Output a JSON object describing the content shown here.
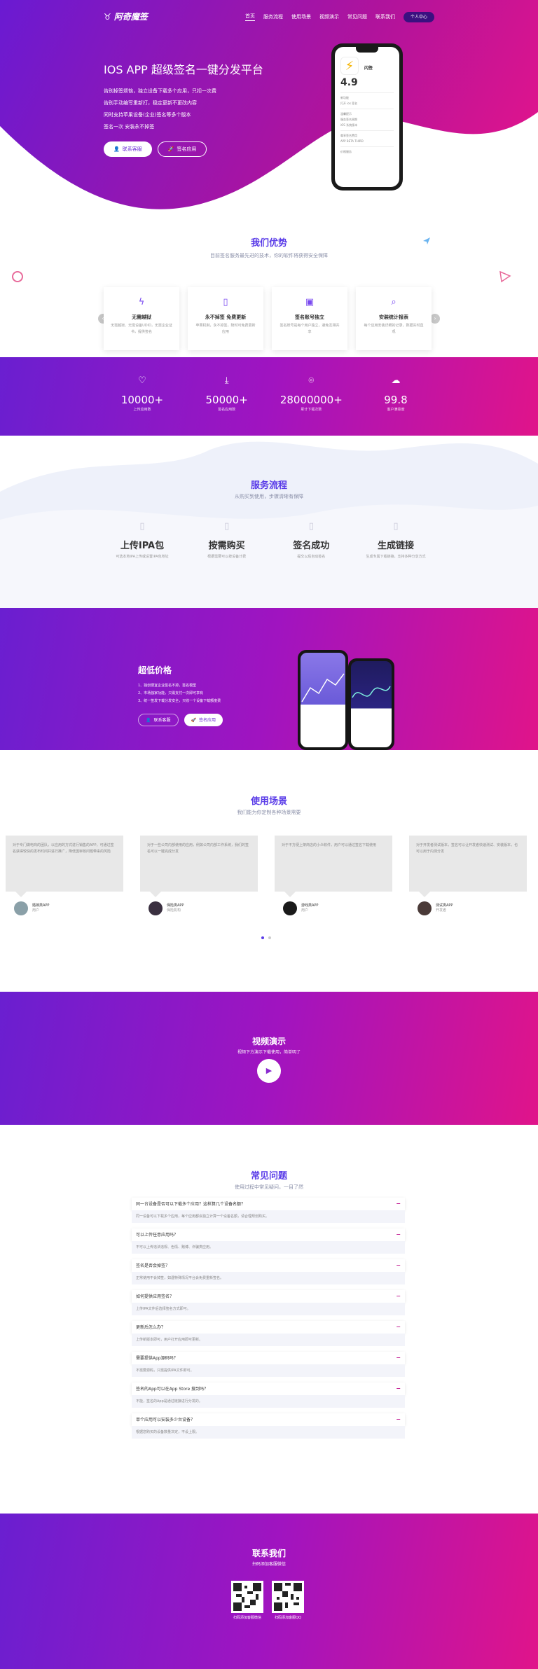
{
  "nav": {
    "brand": "阿奇魔签",
    "items": [
      "首页",
      "服务流程",
      "使用场景",
      "视频演示",
      "常见问题",
      "联系我们"
    ],
    "user_center": "个人中心"
  },
  "hero": {
    "title": "IOS APP 超级签名一键分发平台",
    "lines": [
      "告别掉签烦恼，独立设备下载多个应用，只扣一次费",
      "告别手动编写重新打，稳定更新不更改内容",
      "同时支持苹果设备(企业)签名等多个版本",
      "签名一次 安装永不掉签"
    ],
    "btn_contact": "联系客服",
    "btn_sign": "签名应用"
  },
  "phone": {
    "app": "闪签",
    "rating": "4.9",
    "lines": [
      "新功能",
      "打开 ios 签名",
      "温馨提示",
      "服务签名周期",
      "iOS 系统版本",
      "尊享签名费用",
      "APP BETA THIRD",
      "价格服务"
    ]
  },
  "advantages": {
    "title": "我们优势",
    "subtitle": "目前签名服务最先进的技术，你的软件将获得安全保障",
    "cards": [
      {
        "icon": "flash-icon",
        "title": "无需越狱",
        "desc": "无需越狱、无需设备UDID，无需企业证书，提供签名"
      },
      {
        "icon": "mobile-icon",
        "title": "永不掉签 免费更新",
        "desc": "苹果机制，永不掉签，随时可免费更新应用"
      },
      {
        "icon": "phone-lock-icon",
        "title": "签名账号独立",
        "desc": "签名账号是每个用户独立，避免互相共享"
      },
      {
        "icon": "search-icon",
        "title": "安装统计报表",
        "desc": "每个应用安装详细的记录，数据实时直观"
      }
    ]
  },
  "stats": [
    {
      "icon": "heart-icon",
      "value": "10000+",
      "label": "上传应用数"
    },
    {
      "icon": "download-icon",
      "value": "50000+",
      "label": "签名应用数"
    },
    {
      "icon": "location-icon",
      "value": "28000000+",
      "label": "累计下载次数"
    },
    {
      "icon": "chat-icon",
      "value": "99.8",
      "label": "客户满意度"
    }
  ],
  "process": {
    "title": "服务流程",
    "subtitle": "从购买到使用，步骤清晰有保障",
    "steps": [
      {
        "title": "上传IPA包",
        "desc": "可选本地IPA上传或设置IPA包地址"
      },
      {
        "title": "按需购买",
        "desc": "根据需要可以按设备计费"
      },
      {
        "title": "签名成功",
        "desc": "提交以后自动签名"
      },
      {
        "title": "生成链接",
        "desc": "生成专属下载链接，支持多种分享方式"
      }
    ]
  },
  "pricing": {
    "title": "超低价格",
    "lines": [
      "1、独创便宜企业签名不掉，签名模型",
      "2、市场独家功能，只需支付一次即可享有",
      "3、统一签发下载分发安全，只收一个设备下载额度费"
    ],
    "btn_contact": "联系客服",
    "btn_sign": "签名应用"
  },
  "scenes": {
    "title": "使用场景",
    "subtitle": "我们能为你定制各种场景需要",
    "items": [
      {
        "text": "对于专门做电商的团队，以应用的方式进行销售的APP，可通过签名获得较快的发布时间并进行推广，降低因审核问题带来的风险",
        "name": "婚嫁类APP",
        "role": "用户"
      },
      {
        "text": "对于一些公司内部使用的应用，例如公司内部工作系统，我们的签名可以一键完成分发",
        "name": "保险类APP",
        "role": "保险机构"
      },
      {
        "text": "对于不方便上架商店的小众软件，用户可以通过签名下载使用",
        "name": "游戏类APP",
        "role": "用户"
      },
      {
        "text": "对于开发者测试版本，签名可以让开发者快速测试、安装版本，也可以用于内测分发",
        "name": "测试类APP",
        "role": "开发者"
      }
    ]
  },
  "video": {
    "title": "视频演示",
    "subtitle": "视频下方演示下载使用，简单明了"
  },
  "faq": {
    "title": "常见问题",
    "subtitle": "使用过程中常见疑问，一目了然",
    "items": [
      {
        "q": "同一台设备是否可以下载多个应用？这样算几个设备名额？",
        "a": "同一设备可以下载多个应用，每个应用都会独立计算一个设备名额，请合理规划购买。"
      },
      {
        "q": "可以上传任意应用吗？",
        "a": "不可以上传违法违规、色情、赌博、诈骗类应用。"
      },
      {
        "q": "签名是否会掉签？",
        "a": "正常使用不会掉签，如遇特殊情况平台会免费重新签名。"
      },
      {
        "q": "如何提供应用签名？",
        "a": "上传IPA文件后选择签名方式即可。"
      },
      {
        "q": "更新后怎么办？",
        "a": "上传新版本即可，用户打开应用即可更新。"
      },
      {
        "q": "需要提供App源码吗？",
        "a": "不需要源码，只需提供IPA文件即可。"
      },
      {
        "q": "签名的App可以在App Store 搜到吗？",
        "a": "不能，签名的App是通过链接进行分发的。"
      },
      {
        "q": "单个应用可以安装多少台设备？",
        "a": "根据您购买的设备数量决定，不设上限。"
      }
    ]
  },
  "contact": {
    "title": "联系我们",
    "subtitle": "扫码添加客服微信",
    "qrs": [
      {
        "label": "扫码添加客服微信"
      },
      {
        "label": "扫码添加客服QQ"
      }
    ]
  }
}
